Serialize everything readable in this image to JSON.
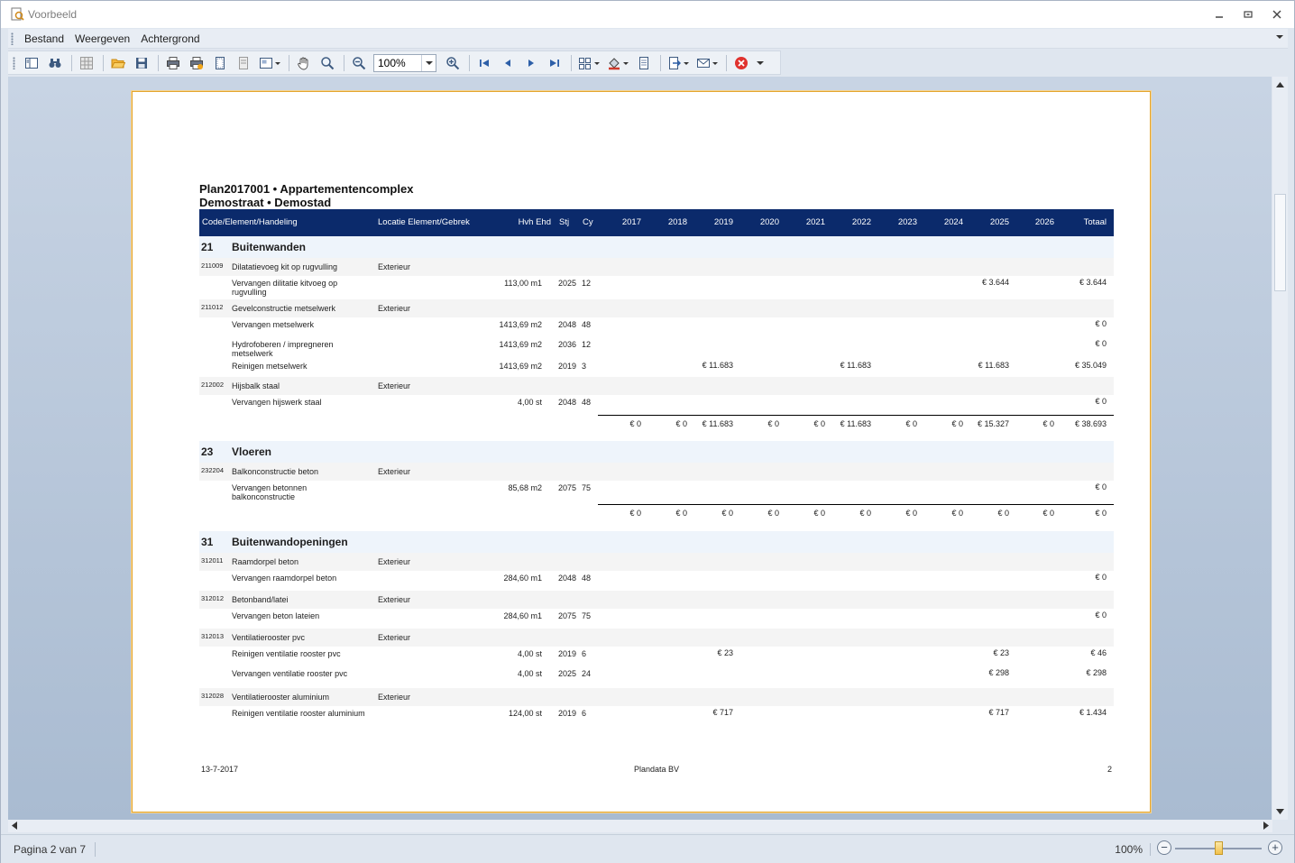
{
  "window": {
    "title": "Voorbeeld"
  },
  "menu": {
    "items": [
      "Bestand",
      "Weergeven",
      "Achtergrond"
    ]
  },
  "toolbar": {
    "zoom_value": "100%"
  },
  "status": {
    "page_info": "Pagina 2 van 7",
    "zoom_label": "100%",
    "zoom_fraction": 0.5
  },
  "report": {
    "title_line1": "Plan2017001 • Appartementencomplex",
    "title_line2": "Demostraat • Demostad",
    "headers": {
      "code": "Code/Element/Handeling",
      "loc": "Locatie Element/Gebrek",
      "hvh": "Hvh Ehd",
      "stj": "Stj",
      "cy": "Cy",
      "years": [
        "2017",
        "2018",
        "2019",
        "2020",
        "2021",
        "2022",
        "2023",
        "2024",
        "2025",
        "2026"
      ],
      "total": "Totaal"
    },
    "footer": {
      "date": "13-7-2017",
      "company": "Plandata BV",
      "page": "2"
    }
  },
  "rows": [
    {
      "type": "group",
      "code": "21",
      "name": "Buitenwanden"
    },
    {
      "type": "elem",
      "code": "211009",
      "name": "Dilatatievoeg kit op rugvulling",
      "loc": "Exterieur"
    },
    {
      "type": "act",
      "name": "Vervangen dilitatie kitvoeg op rugvulling",
      "qty": "113,00 m1",
      "stj": "2025",
      "cy": "12",
      "vals": [
        "",
        "",
        "",
        "",
        "",
        "",
        "",
        "",
        "€ 3.644",
        ""
      ],
      "total": "€ 3.644",
      "h": 26
    },
    {
      "type": "elem",
      "code": "211012",
      "name": "Gevelconstructie metselwerk",
      "loc": "Exterieur"
    },
    {
      "type": "act",
      "name": "Vervangen metselwerk",
      "qty": "1413,69 m2",
      "stj": "2048",
      "cy": "48",
      "vals": [
        "",
        "",
        "",
        "",
        "",
        "",
        "",
        "",
        "",
        ""
      ],
      "total": "€ 0",
      "h": 22
    },
    {
      "type": "act",
      "name": "Hydrofoberen / impregneren metselwerk",
      "qty": "1413,69 m2",
      "stj": "2036",
      "cy": "12",
      "vals": [
        "",
        "",
        "",
        "",
        "",
        "",
        "",
        "",
        "",
        ""
      ],
      "total": "€ 0",
      "h": 24
    },
    {
      "type": "act",
      "name": "Reinigen metselwerk",
      "qty": "1413,69 m2",
      "stj": "2019",
      "cy": "3",
      "vals": [
        "",
        "",
        "€ 11.683",
        "",
        "",
        "€ 11.683",
        "",
        "",
        "€ 11.683",
        ""
      ],
      "total": "€ 35.049",
      "h": 20
    },
    {
      "type": "elem",
      "code": "212002",
      "name": "Hijsbalk staal",
      "loc": "Exterieur"
    },
    {
      "type": "act",
      "name": "Vervangen hijswerk staal",
      "qty": "4,00 st",
      "stj": "2048",
      "cy": "48",
      "vals": [
        "",
        "",
        "",
        "",
        "",
        "",
        "",
        "",
        "",
        ""
      ],
      "total": "€ 0",
      "h": 22
    },
    {
      "type": "sum",
      "vals": [
        "€ 0",
        "€ 0",
        "€ 11.683",
        "€ 0",
        "€ 0",
        "€ 11.683",
        "€ 0",
        "€ 0",
        "€ 15.327",
        "€ 0"
      ],
      "total": "€ 38.693"
    },
    {
      "type": "spacer",
      "h": 7
    },
    {
      "type": "group",
      "code": "23",
      "name": "Vloeren"
    },
    {
      "type": "elem",
      "code": "232204",
      "name": "Balkonconstructie beton",
      "loc": "Exterieur"
    },
    {
      "type": "act",
      "name": "Vervangen betonnen balkonconstructie",
      "qty": "85,68 m2",
      "stj": "2075",
      "cy": "75",
      "vals": [
        "",
        "",
        "",
        "",
        "",
        "",
        "",
        "",
        "",
        ""
      ],
      "total": "€ 0",
      "h": 26
    },
    {
      "type": "sum",
      "vals": [
        "€ 0",
        "€ 0",
        "€ 0",
        "€ 0",
        "€ 0",
        "€ 0",
        "€ 0",
        "€ 0",
        "€ 0",
        "€ 0"
      ],
      "total": "€ 0"
    },
    {
      "type": "spacer",
      "h": 8
    },
    {
      "type": "group",
      "code": "31",
      "name": "Buitenwandopeningen"
    },
    {
      "type": "elem",
      "code": "312011",
      "name": "Raamdorpel beton",
      "loc": "Exterieur"
    },
    {
      "type": "act",
      "name": "Vervangen raamdorpel beton",
      "qty": "284,60 m1",
      "stj": "2048",
      "cy": "48",
      "vals": [
        "",
        "",
        "",
        "",
        "",
        "",
        "",
        "",
        "",
        ""
      ],
      "total": "€ 0",
      "h": 22
    },
    {
      "type": "elem",
      "code": "312012",
      "name": "Betonband/latei",
      "loc": "Exterieur"
    },
    {
      "type": "act",
      "name": "Vervangen beton lateien",
      "qty": "284,60 m1",
      "stj": "2075",
      "cy": "75",
      "vals": [
        "",
        "",
        "",
        "",
        "",
        "",
        "",
        "",
        "",
        ""
      ],
      "total": "€ 0",
      "h": 22
    },
    {
      "type": "elem",
      "code": "312013",
      "name": "Ventilatierooster pvc",
      "loc": "Exterieur"
    },
    {
      "type": "act",
      "name": "Reinigen ventilatie rooster pvc",
      "qty": "4,00 st",
      "stj": "2019",
      "cy": "6",
      "vals": [
        "",
        "",
        "€ 23",
        "",
        "",
        "",
        "",
        "",
        "€ 23",
        ""
      ],
      "total": "€ 46",
      "h": 22
    },
    {
      "type": "act",
      "name": "Vervangen ventilatie rooster pvc",
      "qty": "4,00 st",
      "stj": "2025",
      "cy": "24",
      "vals": [
        "",
        "",
        "",
        "",
        "",
        "",
        "",
        "",
        "€ 298",
        ""
      ],
      "total": "€ 298",
      "h": 24
    },
    {
      "type": "elem",
      "code": "312028",
      "name": "Ventilatierooster aluminium",
      "loc": "Exterieur"
    },
    {
      "type": "act",
      "name": "Reinigen ventilatie rooster aluminium",
      "qty": "124,00 st",
      "stj": "2019",
      "cy": "6",
      "vals": [
        "",
        "",
        "€ 717",
        "",
        "",
        "",
        "",
        "",
        "€ 717",
        ""
      ],
      "total": "€ 1.434",
      "h": 22
    }
  ]
}
